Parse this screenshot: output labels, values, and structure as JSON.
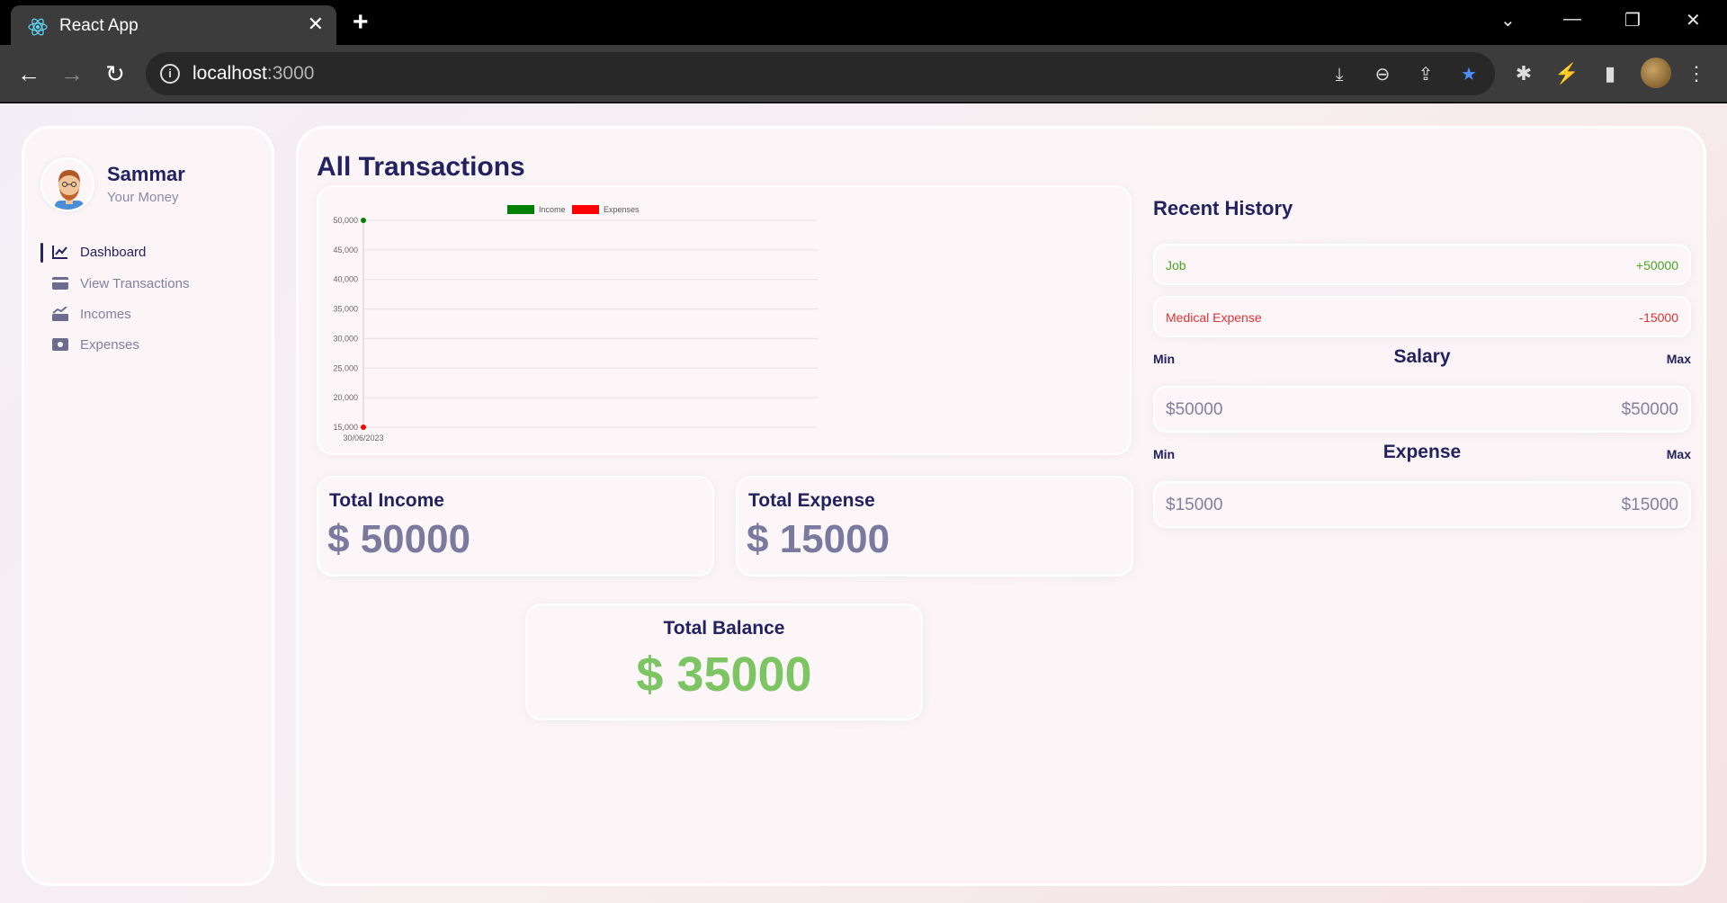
{
  "browser": {
    "tab_title": "React App",
    "url_host": "localhost",
    "url_port": ":3000",
    "close_glyph": "✕",
    "new_tab_glyph": "+"
  },
  "sidebar": {
    "user_name": "Sammar",
    "user_sub": "Your Money",
    "items": [
      {
        "label": "Dashboard",
        "icon": "chart-line-icon",
        "active": true
      },
      {
        "label": "View Transactions",
        "icon": "credit-card-icon",
        "active": false
      },
      {
        "label": "Incomes",
        "icon": "money-trend-icon",
        "active": false
      },
      {
        "label": "Expenses",
        "icon": "money-bill-icon",
        "active": false
      }
    ]
  },
  "main": {
    "title": "All Transactions",
    "total_income_label": "Total Income",
    "total_income_value": "$ 50000",
    "total_expense_label": "Total Expense",
    "total_expense_value": "$ 15000",
    "total_balance_label": "Total Balance",
    "total_balance_value": "$ 35000"
  },
  "history": {
    "title": "Recent History",
    "items": [
      {
        "name": "Job",
        "amount": "+50000",
        "kind": "income"
      },
      {
        "name": "Medical Expense",
        "amount": "-15000",
        "kind": "expense"
      }
    ]
  },
  "ranges": {
    "min_label": "Min",
    "max_label": "Max",
    "salary_title": "Salary",
    "salary_min": "$50000",
    "salary_max": "$50000",
    "expense_title": "Expense",
    "expense_min": "$15000",
    "expense_max": "$15000"
  },
  "colors": {
    "income": "#008000",
    "expense": "#ff0000",
    "primary": "#222260",
    "balance": "#7dc462"
  },
  "chart_data": {
    "type": "line",
    "x": [
      "30/06/2023"
    ],
    "series": [
      {
        "name": "Income",
        "values": [
          50000
        ]
      },
      {
        "name": "Expenses",
        "values": [
          15000
        ]
      }
    ],
    "yticks": [
      "50,000",
      "45,000",
      "40,000",
      "35,000",
      "30,000",
      "25,000",
      "20,000",
      "15,000"
    ],
    "ylim": [
      15000,
      50000
    ],
    "legend": "top",
    "grid": true
  }
}
